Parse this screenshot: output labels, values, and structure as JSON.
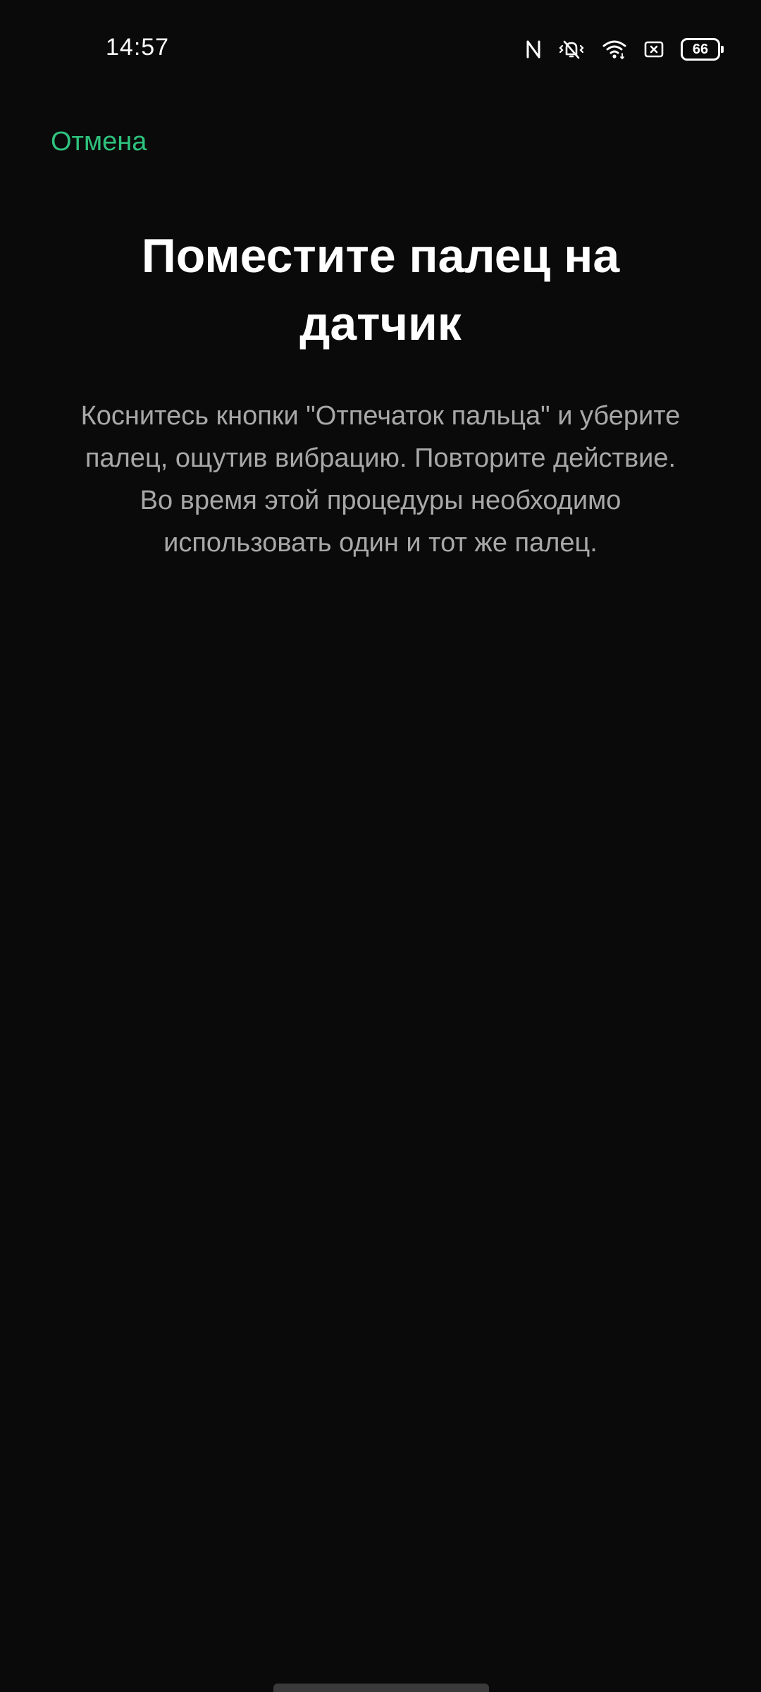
{
  "status_bar": {
    "time": "14:57",
    "battery_level": "66",
    "icons": [
      "nfc-icon",
      "vibrate-mute-icon",
      "wifi-icon",
      "sim-icon",
      "battery-icon"
    ]
  },
  "header": {
    "cancel_label": "Отмена"
  },
  "main": {
    "title": "Поместите палец на датчик",
    "description_line1": "Коснитесь кнопки \"Отпечаток пальца\" и уберите палец, ощутив вибрацию. Повторите действие.",
    "description_line2": "Во время этой процедуры необходимо использовать один и тот же палец."
  },
  "colors": {
    "background": "#0a0a0a",
    "accent": "#2ec27e",
    "text_primary": "#ffffff",
    "text_secondary": "#a8a8a8"
  }
}
